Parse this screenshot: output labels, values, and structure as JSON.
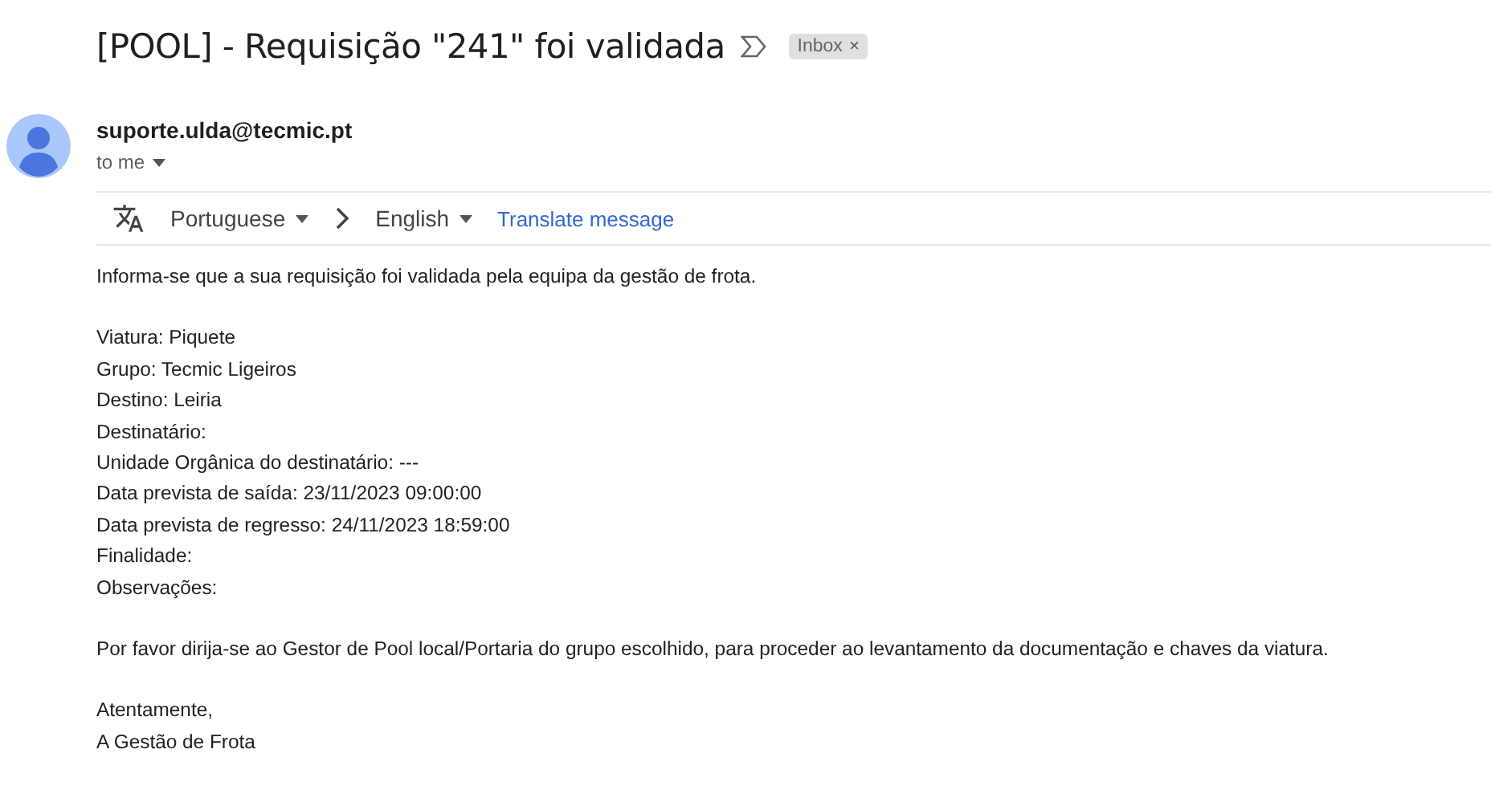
{
  "subject": {
    "title": "[POOL] - Requisição \"241\" foi validada",
    "label": {
      "text": "Inbox",
      "close": "×"
    }
  },
  "sender": {
    "email": "suporte.ulda@tecmic.pt",
    "recipient": "to me"
  },
  "translate": {
    "source": "Portuguese",
    "target": "English",
    "action": "Translate message"
  },
  "body": [
    [
      "Informa-se que a sua requisição foi validada pela equipa da gestão de frota."
    ],
    [
      "Viatura: Piquete",
      "Grupo: Tecmic Ligeiros",
      "Destino: Leiria",
      "Destinatário:",
      "Unidade Orgânica do destinatário: ---",
      "Data prevista de saída: 23/11/2023 09:00:00",
      "Data prevista de regresso: 24/11/2023 18:59:00",
      "Finalidade:",
      "Observações:"
    ],
    [
      "Por favor dirija-se ao Gestor de Pool local/Portaria do grupo escolhido, para proceder ao levantamento da documentação e chaves da viatura."
    ],
    [
      "Atentamente,",
      "A Gestão de Frota"
    ]
  ]
}
